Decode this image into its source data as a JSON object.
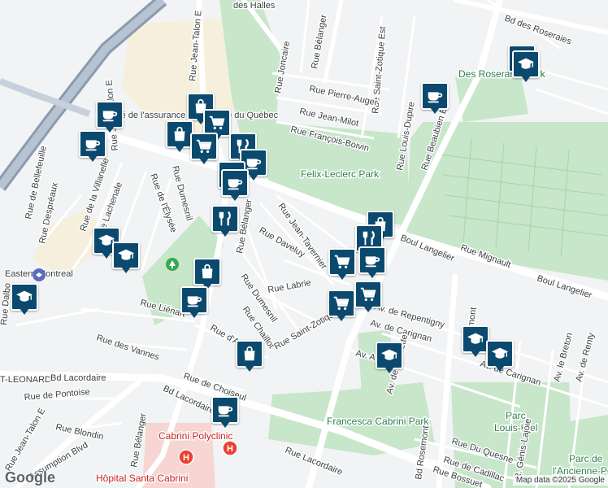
{
  "map": {
    "labels": {
      "rue_des_halles": "des Halles",
      "rue_jean_talon_e": "Rue Jean-Talon E",
      "rue_belanger_n": "Rue Bélanger",
      "rue_joncaire": "Rue Joncaire",
      "rue_st_zotique_est": "Rue Saint-Zotique Est",
      "rue_beaubien_e": "Rue Beaubien E",
      "bd_des_roseraies": "Bd des Roseraies",
      "des_roseraies_park": "Des Roseraies Park",
      "rue_pierre_auger": "Rue Pierre-Auger",
      "rue_jean_milot": "Rue Jean-Milot",
      "rue_francois_boivin": "Rue François-Boivin",
      "rue_louis_dupire": "Rue Louis-Dupire",
      "felix_leclerc_park": "Felix-Leclerc Park",
      "societe": "Société de l'assurance automobile du Québec",
      "rue_talon_e_w": "Rue Jean-Talon E",
      "rue_de_bellefeuille": "Rue de Bellefeuille",
      "rue_despreaux": "Rue Despréaux",
      "rue_de_la_villanelle": "Rue de la Villanelle",
      "rue_lachenale": "Rue Lachenale",
      "rue_de_lelysee": "Rue de l'Élysée",
      "rue_dumesnil": "Rue Dumesnil",
      "rue_belanger_s": "Rue Bélanger",
      "rue_daveluy": "Rue Daveluy",
      "rue_jean_tavernier": "Rue Jean-Tavernier",
      "boul_langelier": "Boul Langelier",
      "boul_langelier_2": "Boul Langelier",
      "rue_mignault": "Rue Mignault",
      "rue_labrie": "Rue Labrie",
      "rue_dumesnil_2": "Rue Dumesnil",
      "rue_chaillot": "Rue Chaillot",
      "rue_saint_zotique": "Rue Saint-Zotique",
      "av_de_repentigny": "Av. de Repentigny",
      "av_de_carignan": "Av. de Carignan",
      "av_de_carignan_2": "Av. de Carignan",
      "rue_lienart": "Rue Liénart",
      "rue_darras": "Rue d'Arras",
      "rue_des_vannes": "Rue des Vannes",
      "eastern_montreal": "Eastern Montreal",
      "st_leonard": "T-LEONARD",
      "bd_lacordaire": "Bd Lacordaire",
      "rue_de_pontoise": "Rue de Pontoise",
      "rue_de_choiseul": "Rue de Choiseul",
      "bd_lacordaire_2": "Bd Lacordaire",
      "rue_blondin": "Rue Blondin",
      "rue_jean_talon_e_sw": "Rue Jean-Talon E",
      "assumption_blvd": "Assumption Blvd",
      "rue_belanger_sw": "Rue Bélanger",
      "cabrini_polyclinic": "Cabrini Polyclinic",
      "hopital_santa_cabrini": "Hôpital Santa Cabrini",
      "rue_lacordaire": "Rue Lacordaire",
      "francesca_cabrini_park": "Francesca Cabrini Park",
      "bd_rosemont": "Bd Rosemont",
      "rosemont_n": "osemont",
      "av_de_charette": "Av. de Charette",
      "rue_du_quesne": "Rue Du Quesne",
      "rue_de_cadillac": "Rue de Cadillac",
      "rue_bossuet": "Rue Bossuet",
      "av_a": "Av. A",
      "parc_louis_riel_1": "Parc",
      "parc_louis_riel_2": "Louis-Riel",
      "parc_ancienne_1": "Parc de",
      "parc_ancienne_2": "l'Ancienne-Po",
      "rue_genis_lajoie": "R. Génis-Lajoie",
      "av_le_breton": "Av. le Breton",
      "av_de_renty": "Av. de Renty",
      "rue_dalbo": "Rue Dalbo"
    },
    "pins": [
      {
        "icon": "graduation-cap-icon",
        "kind": "school"
      },
      {
        "icon": "graduation-cap-icon",
        "kind": "school"
      },
      {
        "icon": "coffee-cup-icon",
        "kind": "cafe"
      },
      {
        "icon": "shopping-bag-icon",
        "kind": "store"
      },
      {
        "icon": "shopping-cart-icon",
        "kind": "supermarket"
      },
      {
        "icon": "coffee-cup-icon",
        "kind": "cafe"
      },
      {
        "icon": "coffee-cup-icon",
        "kind": "cafe"
      },
      {
        "icon": "shopping-bag-icon",
        "kind": "store"
      },
      {
        "icon": "shopping-cart-icon",
        "kind": "supermarket"
      },
      {
        "icon": "fork-knife-icon",
        "kind": "restaurant"
      },
      {
        "icon": "coffee-cup-icon",
        "kind": "cafe"
      },
      {
        "icon": "coffee-cup-icon",
        "kind": "cafe"
      },
      {
        "icon": "coffee-cup-icon",
        "kind": "cafe"
      },
      {
        "icon": "fork-knife-icon",
        "kind": "restaurant"
      },
      {
        "icon": "graduation-cap-icon",
        "kind": "school"
      },
      {
        "icon": "graduation-cap-icon",
        "kind": "school"
      },
      {
        "icon": "shopping-bag-icon",
        "kind": "store"
      },
      {
        "icon": "coffee-cup-icon",
        "kind": "cafe"
      },
      {
        "icon": "graduation-cap-icon",
        "kind": "school"
      },
      {
        "icon": "shopping-bag-icon",
        "kind": "store"
      },
      {
        "icon": "shopping-bag-icon",
        "kind": "store"
      },
      {
        "icon": "fork-knife-icon",
        "kind": "restaurant"
      },
      {
        "icon": "shopping-cart-icon",
        "kind": "supermarket"
      },
      {
        "icon": "coffee-cup-icon",
        "kind": "cafe"
      },
      {
        "icon": "shopping-cart-icon",
        "kind": "supermarket"
      },
      {
        "icon": "shopping-cart-icon",
        "kind": "supermarket"
      },
      {
        "icon": "graduation-cap-icon",
        "kind": "school"
      },
      {
        "icon": "graduation-cap-icon",
        "kind": "school"
      },
      {
        "icon": "graduation-cap-icon",
        "kind": "school"
      },
      {
        "icon": "coffee-cup-icon",
        "kind": "cafe"
      },
      {
        "icon": "hospital-h-icon",
        "kind": "hospital"
      },
      {
        "icon": "hospital-h-icon",
        "kind": "hospital"
      }
    ],
    "colors": {
      "pin_fill": "#0b4a6e",
      "park": "#c8e6c9",
      "road": "#ffffff",
      "highway": "#8a9bb0",
      "hospital": "#e94235"
    }
  },
  "logo": "Google",
  "attribution": "Map data ©2025 Google"
}
